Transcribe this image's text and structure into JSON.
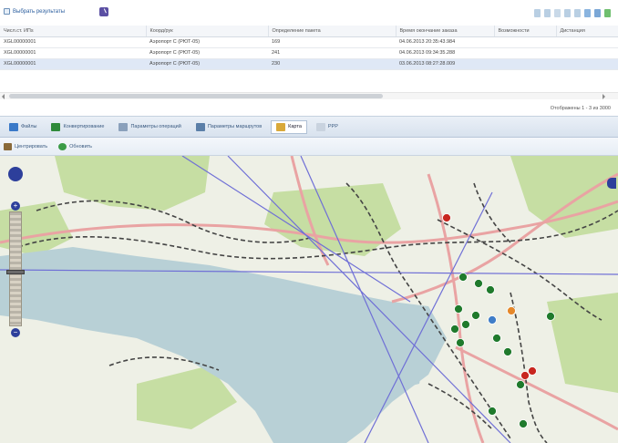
{
  "toolbar": {
    "clear_label": "Выбрать результаты",
    "accent": "#5b4fa3",
    "tool_icons": [
      {
        "name": "first-page-icon",
        "color": "#b9cfe3"
      },
      {
        "name": "prev-page-icon",
        "color": "#b9cfe3"
      },
      {
        "name": "page-icon",
        "color": "#c9d9e8"
      },
      {
        "name": "next-page-icon",
        "color": "#b9cfe3"
      },
      {
        "name": "last-page-icon",
        "color": "#b9cfe3"
      },
      {
        "name": "filter-icon",
        "color": "#8ab4df"
      },
      {
        "name": "filter-clear-icon",
        "color": "#7ba7d6"
      },
      {
        "name": "refresh-icon",
        "color": "#6fbf6f"
      }
    ]
  },
  "table": {
    "columns": [
      "Числ.ст. ИПs",
      "Коорд/рук",
      "Определение пакета",
      "Время окончание заказа",
      "Возможности",
      "Дистанция"
    ],
    "rows": [
      {
        "cells": [
          "XGL00000001",
          "Аэропорт С (РЮТ-05)",
          "169",
          "04.06.2013 20:35:43.984",
          "",
          ""
        ],
        "selected": false
      },
      {
        "cells": [
          "XGL00000001",
          "Аэропорт С (РЮТ-05)",
          "241",
          "04.06.2013 09:34:35.288",
          "",
          ""
        ],
        "selected": false
      },
      {
        "cells": [
          "XGL00000001",
          "Аэропорт С (РЮТ-05)",
          "230",
          "03.06.2013 08:27:28.009",
          "",
          ""
        ],
        "selected": true
      }
    ]
  },
  "status": {
    "count_text": "Отображены 1 - 3 из 3000"
  },
  "tabs": [
    {
      "label": "Файлы",
      "icon": "files-icon",
      "color": "#3a79c8",
      "active": false
    },
    {
      "label": "Конвертирование",
      "icon": "convert-icon",
      "color": "#2f8a3a",
      "active": false
    },
    {
      "label": "Параметры операций",
      "icon": "operations-icon",
      "color": "#8aa0bb",
      "active": false
    },
    {
      "label": "Параметры маршрутов",
      "icon": "routes-icon",
      "color": "#5b7fa8",
      "active": false
    },
    {
      "label": "Карта",
      "icon": "map-icon",
      "color": "#d9a93a",
      "active": true
    },
    {
      "label": "PPP",
      "icon": "ppp-icon",
      "color": "#c9d3df",
      "active": false
    }
  ],
  "subbar": {
    "center_label": "Центрировать",
    "refresh_label": "Обновить",
    "center_color": "#8a6a3a",
    "refresh_color": "#3b9b46"
  },
  "map": {
    "water_color": "#b8d0d6",
    "land_color": "#eef0e6",
    "park_color": "#c6dea3",
    "road_color": "#e9a3a3",
    "track_color": "#444444",
    "line_color": "#6f6fd6",
    "marker_green": "#1f7a2c",
    "marker_red": "#c8261f",
    "marker_blue": "#3f7dc8",
    "marker_orange": "#e5882a"
  }
}
